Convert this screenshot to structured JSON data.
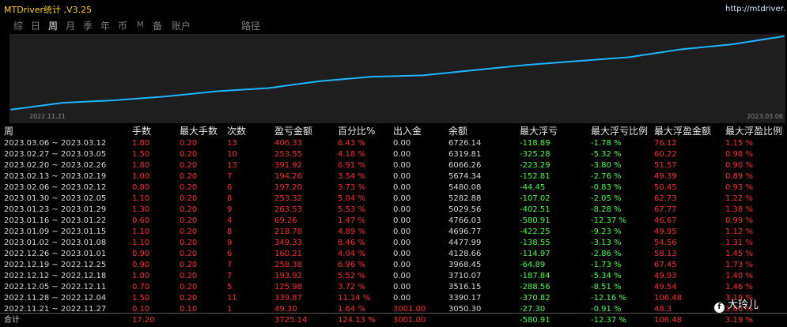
{
  "app": {
    "title": "MTDriver统计 ,V3.25",
    "url": "http://mtdriver."
  },
  "tabs": [
    {
      "label": "综"
    },
    {
      "label": "日"
    },
    {
      "label": "周"
    },
    {
      "label": "月"
    },
    {
      "label": "季"
    },
    {
      "label": "年"
    },
    {
      "label": "币"
    },
    {
      "label": "M"
    },
    {
      "label": "备"
    },
    {
      "label": "账户"
    },
    {
      "label": "路径"
    }
  ],
  "active_tab": "周",
  "chart": {
    "start_label": "2022.11.21",
    "end_label": "2023.03.06",
    "line_color": "#1eb4ff"
  },
  "chart_data": {
    "type": "line",
    "x": [
      "2022.11.21",
      "2022.11.28",
      "2022.12.05",
      "2022.12.12",
      "2022.12.19",
      "2022.12.26",
      "2023.01.02",
      "2023.01.09",
      "2023.01.16",
      "2023.01.23",
      "2023.01.30",
      "2023.02.06",
      "2023.02.13",
      "2023.02.20",
      "2023.02.27",
      "2023.03.06"
    ],
    "series": [
      {
        "values": [
          3050.3,
          3390.17,
          3516.15,
          3710.07,
          3968.45,
          4128.66,
          4477.99,
          4696.77,
          4766.03,
          5029.56,
          5282.88,
          5480.08,
          5674.34,
          6066.26,
          6319.81,
          6726.14
        ]
      }
    ],
    "ylim": [
      3000,
      6760
    ]
  },
  "columns": [
    "周",
    "手数",
    "最大手数",
    "次数",
    "盈亏金额",
    "百分比%",
    "出入金",
    "余额",
    "最大浮亏",
    "最大浮亏比例",
    "最大浮盈金额",
    "最大浮盈比例"
  ],
  "rows": [
    [
      "2023.03.06 ~ 2023.03.12",
      "1.80",
      "0.20",
      "13",
      "406.33",
      "6.43 %",
      "0.00",
      "6726.14",
      "-118.89",
      "-1.78 %",
      "76.12",
      "1.15 %"
    ],
    [
      "2023.02.27 ~ 2023.03.05",
      "1.50",
      "0.20",
      "10",
      "253.55",
      "4.18 %",
      "0.00",
      "6319.81",
      "-325.28",
      "-5.32 %",
      "60.22",
      "0.98 %"
    ],
    [
      "2023.02.20 ~ 2023.02.26",
      "1.80",
      "0.20",
      "13",
      "391.92",
      "6.91 %",
      "0.00",
      "6066.26",
      "-223.29",
      "-3.80 %",
      "51.57",
      "0.90 %"
    ],
    [
      "2023.02.13 ~ 2023.02.19",
      "1.00",
      "0.20",
      "7",
      "194.26",
      "3.54 %",
      "0.00",
      "5674.34",
      "-152.81",
      "-2.76 %",
      "49.39",
      "0.89 %"
    ],
    [
      "2023.02.06 ~ 2023.02.12",
      "0.80",
      "0.20",
      "6",
      "197.20",
      "3.73 %",
      "0.00",
      "5480.08",
      "-44.45",
      "-0.83 %",
      "50.45",
      "0.93 %"
    ],
    [
      "2023.01.30 ~ 2023.02.05",
      "1.10",
      "0.20",
      "8",
      "253.32",
      "5.04 %",
      "0.00",
      "5282.88",
      "-107.02",
      "-2.05 %",
      "62.73",
      "1.22 %"
    ],
    [
      "2023.01.23 ~ 2023.01.29",
      "1.30",
      "0.20",
      "9",
      "263.53",
      "5.53 %",
      "0.00",
      "5029.56",
      "-402.51",
      "-8.28 %",
      "67.77",
      "1.38 %"
    ],
    [
      "2023.01.16 ~ 2023.01.22",
      "0.60",
      "0.20",
      "4",
      "69.26",
      "1.47 %",
      "0.00",
      "4766.03",
      "-580.91",
      "-12.37 %",
      "46.67",
      "0.99 %"
    ],
    [
      "2023.01.09 ~ 2023.01.15",
      "1.10",
      "0.20",
      "8",
      "218.78",
      "4.89 %",
      "0.00",
      "4696.77",
      "-422.25",
      "-9.23 %",
      "49.95",
      "1.12 %"
    ],
    [
      "2023.01.02 ~ 2023.01.08",
      "1.10",
      "0.20",
      "9",
      "349.33",
      "8.46 %",
      "0.00",
      "4477.99",
      "-138.55",
      "-3.13 %",
      "54.56",
      "1.31 %"
    ],
    [
      "2022.12.26 ~ 2023.01.01",
      "0.90",
      "0.20",
      "6",
      "160.21",
      "4.04 %",
      "0.00",
      "4128.66",
      "-114.97",
      "-2.86 %",
      "58.13",
      "1.45 %"
    ],
    [
      "2022.12.19 ~ 2022.12.25",
      "0.90",
      "0.20",
      "7",
      "258.38",
      "6.96 %",
      "0.00",
      "3968.45",
      "-64.89",
      "-1.73 %",
      "67.45",
      "1.73 %"
    ],
    [
      "2022.12.12 ~ 2022.12.18",
      "1.00",
      "0.20",
      "7",
      "193.92",
      "5.52 %",
      "0.00",
      "3710.07",
      "-187.84",
      "-5.34 %",
      "49.93",
      "1.40 %"
    ],
    [
      "2022.12.05 ~ 2022.12.11",
      "0.70",
      "0.20",
      "5",
      "125.98",
      "3.72 %",
      "0.00",
      "3516.15",
      "-288.56",
      "-8.51 %",
      "49.54",
      "1.46 %"
    ],
    [
      "2022.11.28 ~ 2022.12.04",
      "1.50",
      "0.20",
      "11",
      "339.87",
      "11.14 %",
      "0.00",
      "3390.17",
      "-370.82",
      "-12.16 %",
      "106.48",
      "3.19 %"
    ],
    [
      "2022.11.21 ~ 2022.11.27",
      "0.10",
      "0.10",
      "1",
      "49.30",
      "1.64 %",
      "3001.00",
      "3050.30",
      "-27.30",
      "-0.91 %",
      "48.3",
      "1.66 %"
    ]
  ],
  "total": [
    "合计",
    "17.20",
    "",
    "",
    "3725.14",
    "124.13 %",
    "3001.00",
    "",
    "-580.91",
    "-12.37 %",
    "106.48",
    "3.19 %"
  ],
  "watermark": "大玲儿"
}
